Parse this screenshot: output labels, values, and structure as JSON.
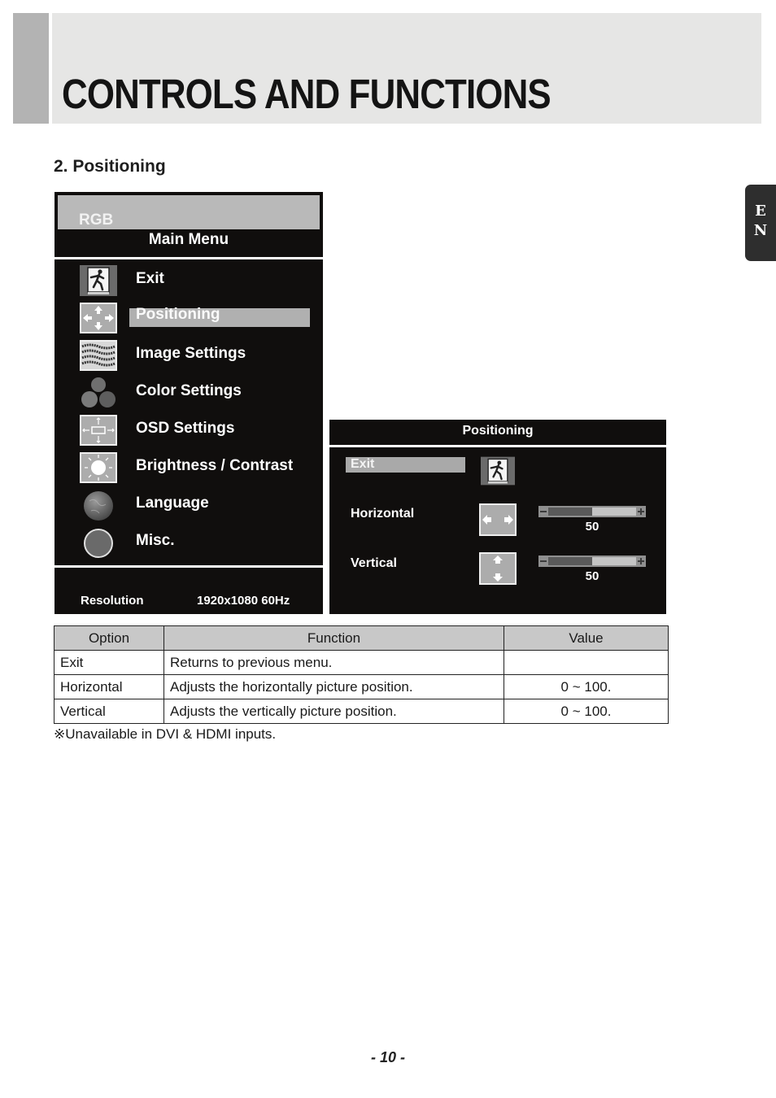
{
  "header": {
    "title": "CONTROLS AND FUNCTIONS"
  },
  "section": {
    "title": "2. Positioning"
  },
  "language_tab": {
    "line1": "E",
    "line2": "N"
  },
  "main_menu": {
    "source": "RGB",
    "title": "Main Menu",
    "items": [
      {
        "label": "Exit",
        "icon": "exit-icon",
        "active": false
      },
      {
        "label": "Positioning",
        "icon": "positioning-arrows-icon",
        "active": true
      },
      {
        "label": "Image Settings",
        "icon": "image-settings-icon",
        "active": false
      },
      {
        "label": "Color Settings",
        "icon": "color-circles-icon",
        "active": false
      },
      {
        "label": "OSD Settings",
        "icon": "osd-settings-icon",
        "active": false
      },
      {
        "label": "Brightness / Contrast",
        "icon": "sun-icon",
        "active": false
      },
      {
        "label": "Language",
        "icon": "globe-icon",
        "active": false
      },
      {
        "label": "Misc.",
        "icon": "misc-circle-icon",
        "active": false
      }
    ],
    "resolution_label": "Resolution",
    "resolution_value": "1920x1080 60Hz"
  },
  "submenu": {
    "title": "Positioning",
    "exit_label": "Exit",
    "horizontal": {
      "label": "Horizontal",
      "value": "50",
      "fraction": 0.5
    },
    "vertical": {
      "label": "Vertical",
      "value": "50",
      "fraction": 0.5
    }
  },
  "table": {
    "headers": [
      "Option",
      "Function",
      "Value"
    ],
    "rows": [
      [
        "Exit",
        "Returns to previous menu.",
        ""
      ],
      [
        "Horizontal",
        "Adjusts the horizontally picture position.",
        "0 ~ 100."
      ],
      [
        "Vertical",
        "Adjusts the vertically picture position.",
        "0 ~ 100."
      ]
    ]
  },
  "note": "※Unavailable in DVI & HDMI inputs.",
  "page_number": "- 10 -"
}
